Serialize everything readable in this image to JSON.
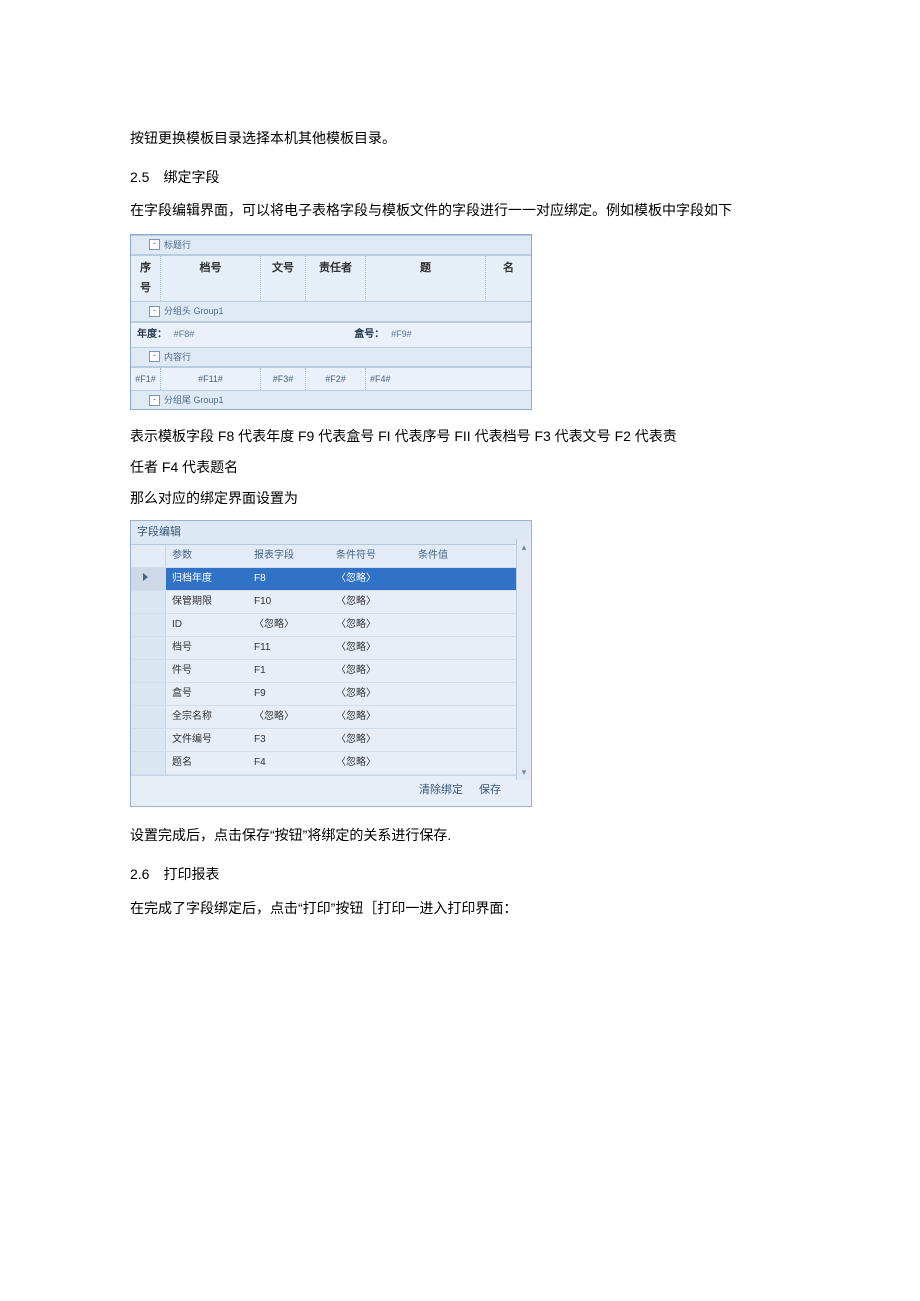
{
  "para_top": "按钮更换模板目录选择本机其他模板目录。",
  "sec25_heading": "2.5　绑定字段",
  "sec25_intro": "在字段编辑界面，可以将电子表格字段与模板文件的字段进行一一对应绑定。例如模板中字段如下",
  "tpl": {
    "band_title": "标题行",
    "header_cols": [
      "序号",
      "档号",
      "文号",
      "责任者",
      "题",
      "名"
    ],
    "band_group": "分组头 Group1",
    "group_left_label": "年度：",
    "group_left_val": "#F8#",
    "group_right_label": "盒号：",
    "group_right_val": "#F9#",
    "band_body": "内容行",
    "body_cells": [
      "#F1#",
      "#F11#",
      "#F3#",
      "#F2#",
      "#F4#"
    ],
    "band_footer": "分组尾 Group1"
  },
  "after_tpl_1": "表示模板字段 F8 代表年度 F9 代表盒号 FI 代表序号 FII 代表档号 F3 代表文号 F2 代表责",
  "after_tpl_2": "任者 F4 代表题名",
  "after_tpl_3": "那么对应的绑定界面设置为",
  "editor": {
    "title": "字段编辑",
    "head": [
      "参数",
      "报表字段",
      "条件符号",
      "条件值"
    ],
    "rows": [
      {
        "sel": true,
        "c": [
          "归档年度",
          "F8",
          "〈忽略〉",
          ""
        ]
      },
      {
        "sel": false,
        "c": [
          "保管期限",
          "F10",
          "〈忽略〉",
          ""
        ]
      },
      {
        "sel": false,
        "c": [
          "ID",
          "〈忽略〉",
          "〈忽略〉",
          ""
        ]
      },
      {
        "sel": false,
        "c": [
          "档号",
          "F11",
          "〈忽略〉",
          ""
        ]
      },
      {
        "sel": false,
        "c": [
          "件号",
          "F1",
          "〈忽略〉",
          ""
        ]
      },
      {
        "sel": false,
        "c": [
          "盒号",
          "F9",
          "〈忽略〉",
          ""
        ]
      },
      {
        "sel": false,
        "c": [
          "全宗名称",
          "〈忽略〉",
          "〈忽略〉",
          ""
        ]
      },
      {
        "sel": false,
        "c": [
          "文件编号",
          "F3",
          "〈忽略〉",
          ""
        ]
      },
      {
        "sel": false,
        "c": [
          "题名",
          "F4",
          "〈忽略〉",
          ""
        ]
      }
    ],
    "btn_clear": "清除绑定",
    "btn_save": "保存"
  },
  "after_editor": "设置完成后，点击保存“按钮”将绑定的关系进行保存.",
  "sec26_heading": "2.6　打印报表",
  "sec26_body": "在完成了字段绑定后，点击“打印”按钮［打印一进入打印界面："
}
